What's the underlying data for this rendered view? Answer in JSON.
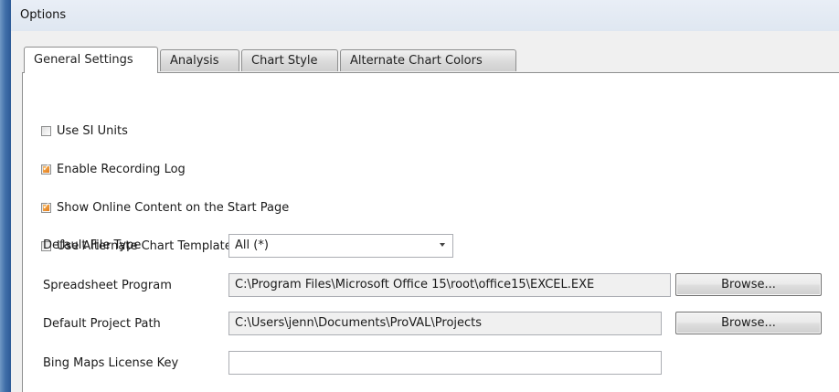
{
  "window": {
    "title": "Options"
  },
  "tabs": [
    {
      "label": "General Settings",
      "active": true
    },
    {
      "label": "Analysis",
      "active": false
    },
    {
      "label": "Chart Style",
      "active": false
    },
    {
      "label": "Alternate Chart Colors",
      "active": false
    }
  ],
  "checkboxes": [
    {
      "label": "Use SI Units",
      "checked": false
    },
    {
      "label": "Enable Recording Log",
      "checked": true
    },
    {
      "label": "Show Online Content on the Start Page",
      "checked": true
    },
    {
      "label": "Use Alternate Chart Template for printing and PDF reports.",
      "checked": false
    }
  ],
  "fields": {
    "file_type": {
      "label": "Default File Type",
      "value": "All (*)"
    },
    "spreadsheet": {
      "label": "Spreadsheet Program",
      "value": "C:\\Program Files\\Microsoft Office 15\\root\\office15\\EXCEL.EXE",
      "button": "Browse..."
    },
    "project_path": {
      "label": "Default Project Path",
      "value": "C:\\Users\\jenn\\Documents\\ProVAL\\Projects",
      "button": "Browse..."
    },
    "bing_key": {
      "label": "Bing Maps License Key",
      "value": ""
    }
  },
  "colors": {
    "accent_check": "#e27a1b",
    "title_bar": "#dfe7f1",
    "panel_bg": "#ffffff"
  }
}
